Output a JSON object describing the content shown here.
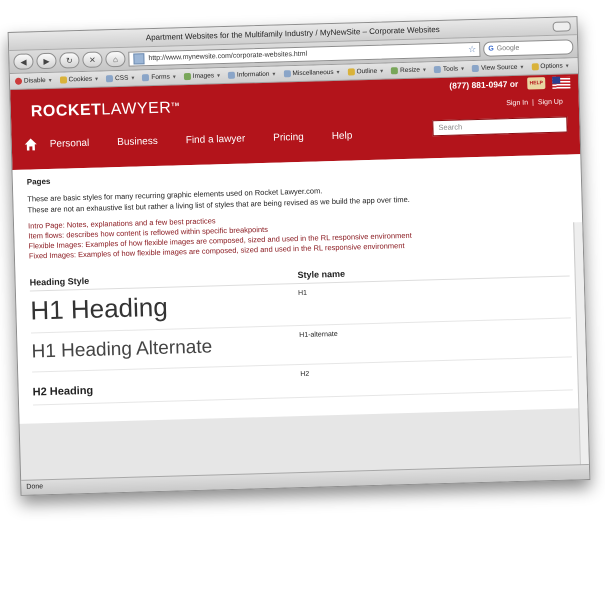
{
  "window": {
    "title": "Apartment Websites for the Multifamily Industry / MyNewSite – Corporate Websites"
  },
  "navbar": {
    "back": "◀",
    "forward": "▶",
    "reload": "↻",
    "stop": "✕",
    "home": "⌂",
    "url": "http://www.mynewsite.com/corporate-websites.html",
    "search_placeholder": "Google"
  },
  "devbar": {
    "items": [
      "Disable",
      "Cookies",
      "CSS",
      "Forms",
      "Images",
      "Information",
      "Miscellaneous",
      "Outline",
      "Resize",
      "Tools",
      "View Source",
      "Options"
    ]
  },
  "site": {
    "logo_bold": "ROCKET",
    "logo_light": "LAWYER",
    "logo_tm": "TM",
    "phone": "(877) 881-0947 or",
    "help_badge": "HELP",
    "signin": "Sign In",
    "divider": "|",
    "signup": "Sign Up",
    "nav": [
      "Personal",
      "Business",
      "Find a lawyer",
      "Pricing",
      "Help"
    ],
    "search_placeholder": "Search"
  },
  "content": {
    "page_title": "Pages",
    "intro1": "These are basic styles for many recurring graphic elements used on Rocket Lawyer.com.",
    "intro2": "These are not an exhaustive list but rather a living list of styles that are being revised as we build the app over time.",
    "links": [
      "Intro Page: Notes, explanations and a few best practices",
      "Item flows: describes how content is reflowed within specific breakpoints",
      "Flexible Images: Examples of how flexible images are composed, sized and used in the RL responsive environment",
      "Fixed Images: Examples of how flexible images are composed, sized and used in the RL responsive environment"
    ],
    "table": {
      "col1": "Heading Style",
      "col2": "Style name",
      "rows": [
        {
          "sample": "H1 Heading",
          "name": "H1"
        },
        {
          "sample": "H1 Heading Alternate",
          "name": "H1-alternate"
        },
        {
          "sample": "H2 Heading",
          "name": "H2"
        }
      ]
    }
  },
  "status": {
    "text": "Done"
  }
}
